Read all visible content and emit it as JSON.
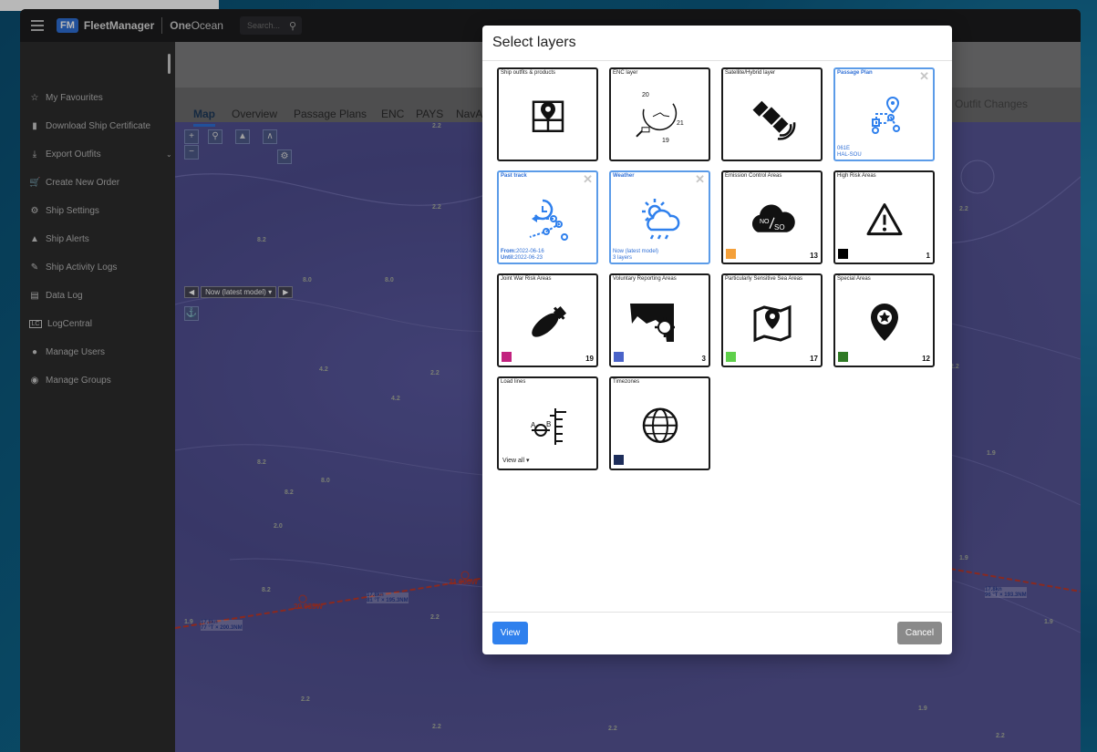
{
  "header": {
    "logo_badge": "FM",
    "app_name": "FleetManager",
    "partner_brand_bold": "One",
    "partner_brand_rest": "Ocean",
    "search_placeholder": "Search..."
  },
  "sidebar": {
    "items": [
      {
        "label": "My Favourites",
        "icon": "star-icon"
      },
      {
        "label": "Download Ship Certificate",
        "icon": "file-icon"
      },
      {
        "label": "Export Outfits",
        "icon": "download-icon"
      },
      {
        "label": "Create New Order",
        "icon": "cart-icon"
      },
      {
        "label": "Ship Settings",
        "icon": "gears-icon"
      },
      {
        "label": "Ship Alerts",
        "icon": "bell-icon"
      },
      {
        "label": "Ship Activity Logs",
        "icon": "log-icon"
      },
      {
        "label": "Data Log",
        "icon": "chart-icon"
      },
      {
        "label": "LogCentral",
        "icon": "lc-icon"
      },
      {
        "label": "Manage Users",
        "icon": "users-icon"
      },
      {
        "label": "Manage Groups",
        "icon": "groups-icon"
      }
    ]
  },
  "tabs": {
    "items": [
      "Map",
      "Overview",
      "Passage Plans",
      "ENC",
      "PAYS",
      "NavA"
    ],
    "right_tab": "Outfit Changes",
    "active": "Map"
  },
  "map": {
    "time_selector": "Now (latest model)",
    "depth_labels": [
      "2.2",
      "8.2",
      "8.0",
      "8.0",
      "4.2",
      "4.2",
      "8.2",
      "8.0",
      "8.2",
      "2.0",
      "8.2",
      "2.2",
      "2.2",
      "1.9",
      "2.2",
      "2.2",
      "2.2",
      "1.9",
      "1.9",
      "1.9",
      "1.9",
      "2.2",
      "2.2",
      "2.2",
      "2.2"
    ],
    "route_labels": [
      "20.035W",
      "21.030W"
    ],
    "speed_labels": [
      {
        "speed": "17.8kn",
        "course": "81 °T × 195.3NM"
      },
      {
        "speed": "17.8kn",
        "course": "77 °T × 200.3NM"
      },
      {
        "speed": "17.8kn",
        "course": "96 °T × 193.3NM"
      }
    ]
  },
  "modal": {
    "title": "Select layers",
    "view_button": "View",
    "cancel_button": "Cancel",
    "tiles": [
      {
        "title": "Ship outfits & products",
        "selected": false,
        "icon": "ship-map-pin-icon"
      },
      {
        "title": "ENC layer",
        "selected": false,
        "icon": "enc-chart-icon"
      },
      {
        "title": "Satellite/Hybrid layer",
        "selected": false,
        "icon": "satellite-icon"
      },
      {
        "title": "Passage Plan",
        "selected": true,
        "icon": "route-plan-icon",
        "sub1": "061E",
        "sub2": "HAL-SOU"
      },
      {
        "title": "Past track",
        "selected": true,
        "icon": "past-track-icon",
        "from_label": "From:",
        "from_date": "2022-06-16",
        "until_label": "Until:",
        "until_date": "2022-06-23"
      },
      {
        "title": "Weather",
        "selected": true,
        "icon": "weather-icon",
        "sub1": "Now (latest model)",
        "sub2": "3 layers"
      },
      {
        "title": "Emission Control Areas",
        "selected": false,
        "icon": "emission-cloud-icon",
        "count": "13",
        "color": "#f4a03a"
      },
      {
        "title": "High Risk Areas",
        "selected": false,
        "icon": "warning-icon",
        "count": "1",
        "color": "#000000"
      },
      {
        "title": "Joint War Risk Areas",
        "selected": false,
        "icon": "bomb-icon",
        "count": "19",
        "color": "#c2227f"
      },
      {
        "title": "Voluntary Reporting Areas",
        "selected": false,
        "icon": "reporting-map-icon",
        "count": "3",
        "color": "#4a63c9"
      },
      {
        "title": "Particularly Sensitive Sea Areas",
        "selected": false,
        "icon": "sensitive-map-icon",
        "count": "17",
        "color": "#5ed04a"
      },
      {
        "title": "Special Areas",
        "selected": false,
        "icon": "special-pin-icon",
        "count": "12",
        "color": "#2f7a25"
      },
      {
        "title": "Load lines",
        "selected": false,
        "icon": "load-line-icon",
        "view_all": "View all"
      },
      {
        "title": "Timezones",
        "selected": false,
        "icon": "globe-clock-icon",
        "color": "#1d2d5a"
      }
    ],
    "enc_numbers": [
      "20",
      "21",
      "19"
    ]
  }
}
